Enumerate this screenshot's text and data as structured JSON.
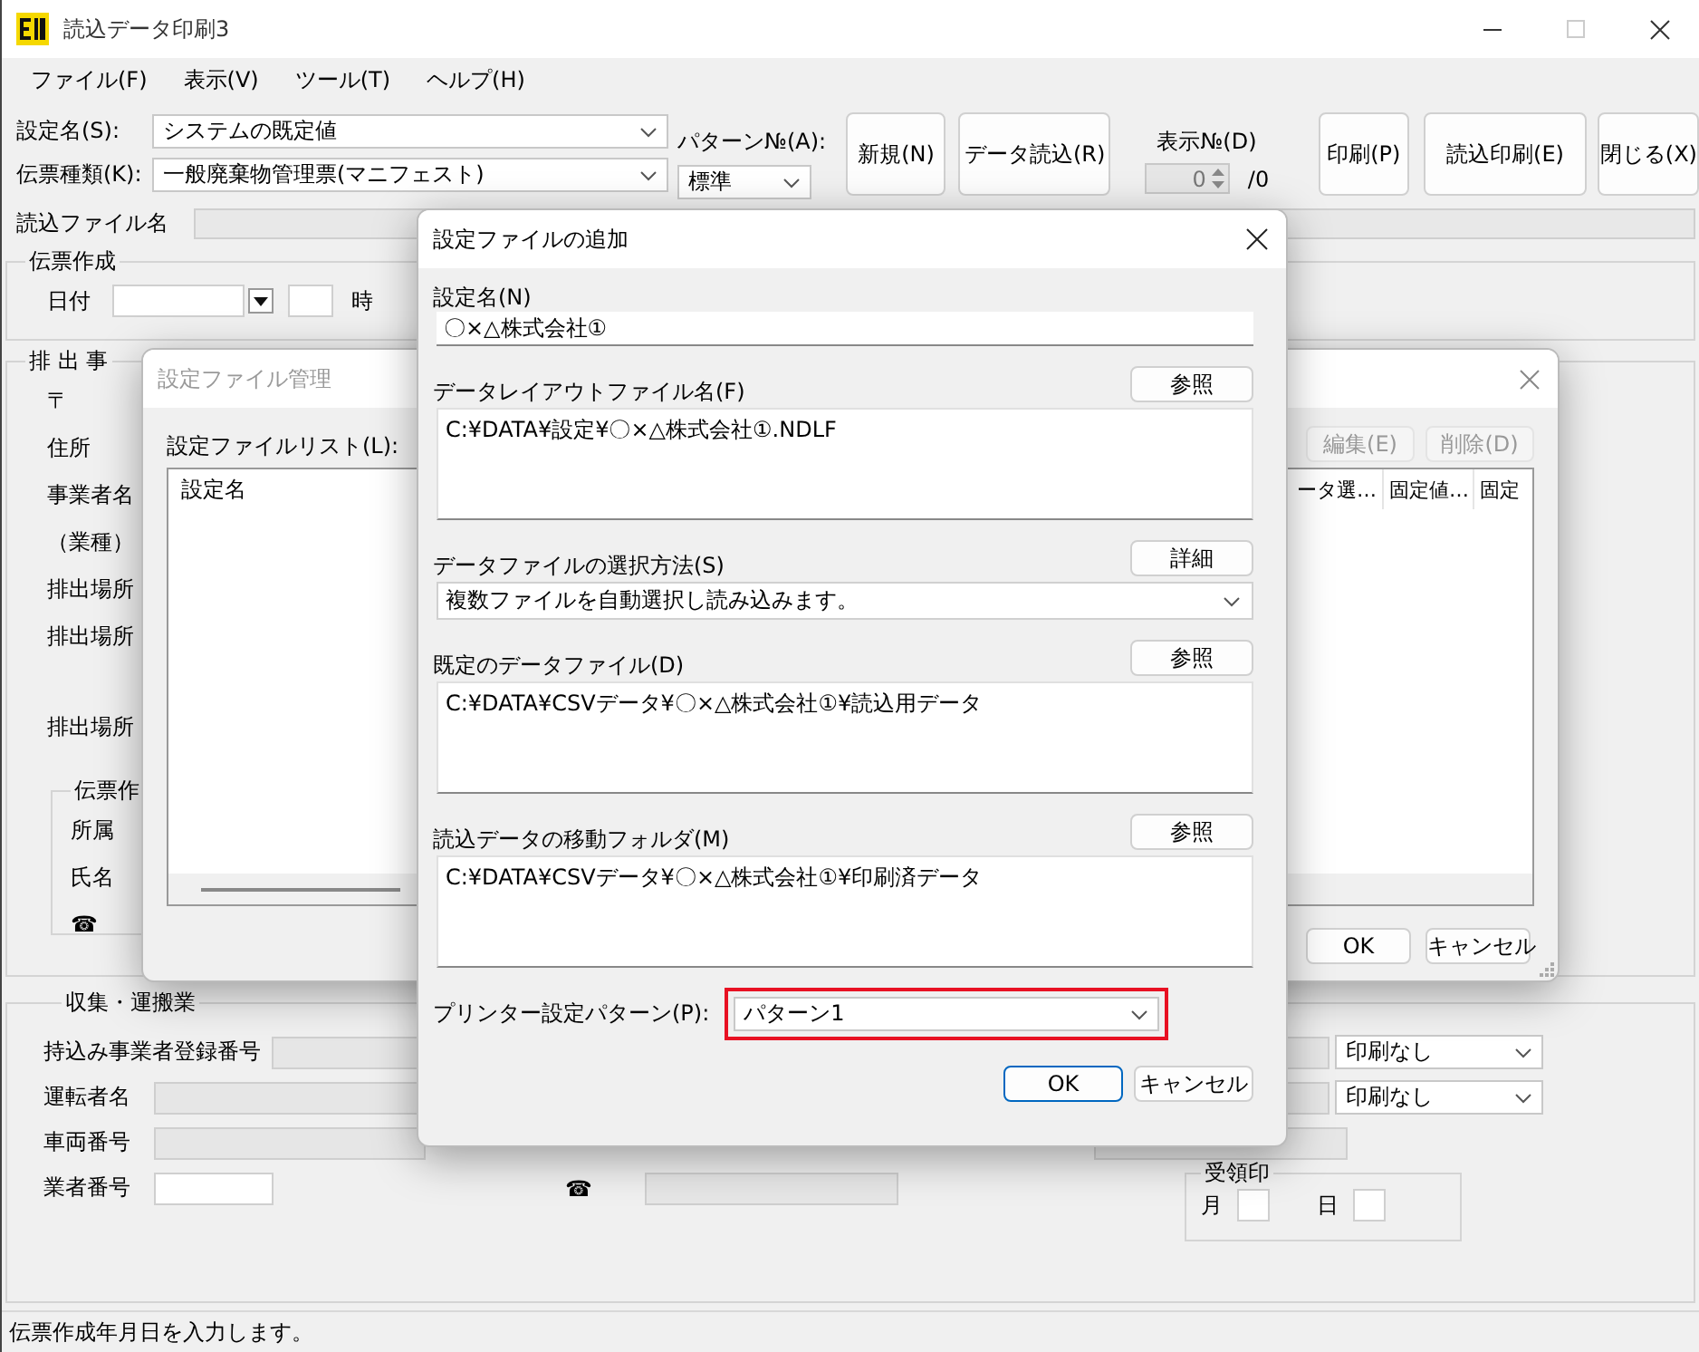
{
  "window": {
    "title": "読込データ印刷3"
  },
  "menu": [
    "ファイル(F)",
    "表示(V)",
    "ツール(T)",
    "ヘルプ(H)"
  ],
  "toolbar": {
    "setting_label": "設定名(S):",
    "setting_value": "システムの既定値",
    "slip_type_label": "伝票種類(K):",
    "slip_type_value": "一般廃棄物管理票(マニフェスト)",
    "pattern_label": "パターン№(A):",
    "pattern_value": "標準",
    "buttons_left": [
      "新規(N)",
      "データ読込(R)"
    ],
    "display_label": "表示№(D)",
    "display_value": "0",
    "display_total": "/0",
    "buttons_right": [
      "印刷(P)",
      "読込印刷(E)",
      "閉じる(X)"
    ]
  },
  "read_file": {
    "label": "読込ファイル名"
  },
  "slip_section": {
    "title": "伝票作成",
    "date_label": "日付",
    "hour_label": "時"
  },
  "issuer_section": {
    "title": "排 出 事",
    "labels": [
      "〒",
      "住所",
      "事業者名",
      "（業種）",
      "排出場所",
      "排出場所",
      "排出場所"
    ],
    "creator": {
      "title": "伝票作",
      "labels": [
        "所属",
        "氏名",
        "☎"
      ]
    }
  },
  "carrier_section": {
    "title": "収集・運搬業",
    "rows": [
      {
        "label": "持込み事業者登録番号"
      },
      {
        "label": "運転者名"
      },
      {
        "label": "車両番号"
      },
      {
        "label": "業者番号"
      }
    ],
    "phone_label": "☎",
    "print_options": [
      "印刷なし",
      "印刷なし"
    ],
    "stamp": {
      "title": "受領印",
      "month": "月",
      "day": "日"
    }
  },
  "status_bar": "伝票作成年月日を入力します。",
  "manager_dialog": {
    "title": "設定ファイル管理",
    "list_label": "設定ファイルリスト(L):",
    "first_column": "設定名",
    "columns": [
      "ータ選…",
      "固定値…",
      "固定"
    ],
    "buttons": [
      {
        "label": "編集(E)",
        "disabled": true
      },
      {
        "label": "削除(D)",
        "disabled": true
      }
    ],
    "footer_buttons": [
      "OK",
      "キャンセル"
    ]
  },
  "add_dialog": {
    "title": "設定ファイルの追加",
    "name_label": "設定名(N)",
    "name_value": "〇×△株式会社①",
    "sections": [
      {
        "kind": "textarea",
        "label": "データレイアウトファイル名(F)",
        "button": "参照",
        "value": "C:¥DATA¥設定¥〇×△株式会社①.NDLF"
      },
      {
        "kind": "select",
        "label": "データファイルの選択方法(S)",
        "button": "詳細",
        "value": "複数ファイルを自動選択し読み込みます。"
      },
      {
        "kind": "textarea",
        "label": "既定のデータファイル(D)",
        "button": "参照",
        "value": "C:¥DATA¥CSVデータ¥〇×△株式会社①¥読込用データ"
      },
      {
        "kind": "textarea",
        "label": "読込データの移動フォルダ(M)",
        "button": "参照",
        "value": "C:¥DATA¥CSVデータ¥〇×△株式会社①¥印刷済データ"
      }
    ],
    "printer_label": "プリンター設定パターン(P):",
    "printer_value": "パターン1",
    "printer_highlighted": true,
    "buttons": [
      "OK",
      "キャンセル"
    ]
  }
}
